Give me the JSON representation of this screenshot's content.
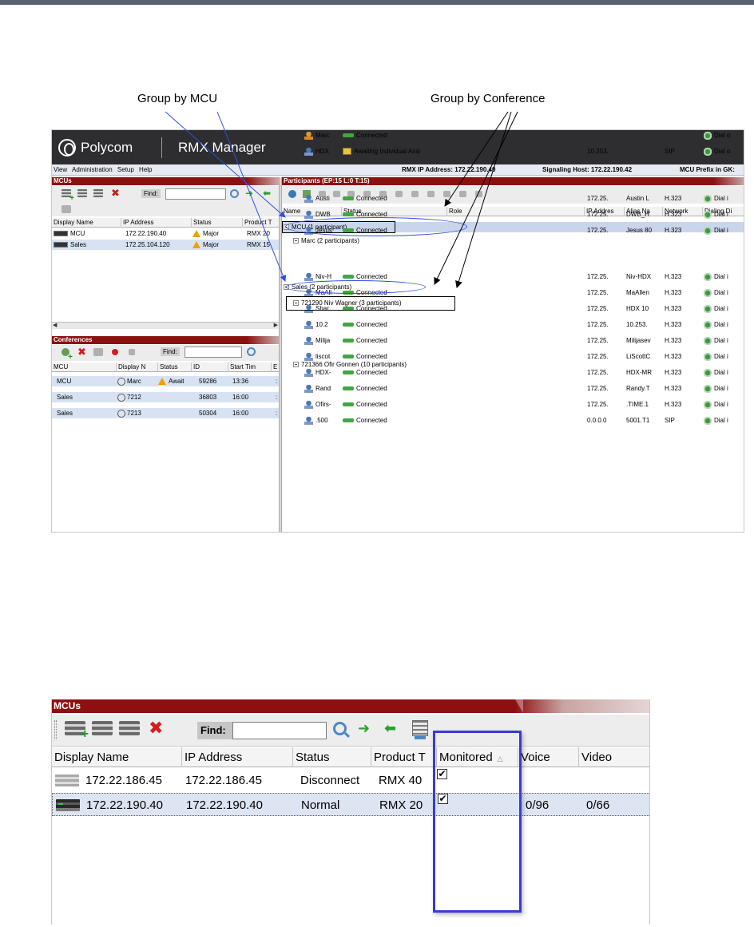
{
  "annotations": {
    "group_by_mcu": "Group by MCU",
    "group_by_conference": "Group by Conference"
  },
  "app": {
    "brand": "Polycom",
    "product": "RMX Manager",
    "menu": [
      "View",
      "Administration",
      "Setup",
      "Help"
    ],
    "rmx_ip": "RMX IP Address: 172.22.190.40",
    "signaling_host": "Signaling Host: 172.22.190.42",
    "mcu_prefix": "MCU Prefix in GK:"
  },
  "mcus_small": {
    "title": "MCUs",
    "find_label": "Find:",
    "columns": [
      "Display Name",
      "IP Address",
      "Status",
      "Product T"
    ],
    "rows": [
      {
        "name": "MCU",
        "ip": "172.22.190.40",
        "status": "Major",
        "product": "RMX 20"
      },
      {
        "name": "Sales",
        "ip": "172.25.104.120",
        "status": "Major",
        "product": "RMX 15"
      }
    ]
  },
  "conferences": {
    "title": "Conferences",
    "find_label": "Find:",
    "columns": [
      "MCU",
      "Display N",
      "Status",
      "ID",
      "Start Tim",
      "E"
    ],
    "rows": [
      {
        "mcu": "MCU",
        "name": "Marc",
        "status": "Await",
        "id": "59286",
        "start": "13:36",
        "end": ":"
      },
      {
        "mcu": "Sales",
        "name": "7212",
        "status": "",
        "id": "36803",
        "start": "16:00",
        "end": ":"
      },
      {
        "mcu": "Sales",
        "name": "7213",
        "status": "",
        "id": "50304",
        "start": "16:00",
        "end": ":"
      }
    ]
  },
  "participants": {
    "title": "Participants (EP:15 L:0 T:15)",
    "columns": [
      "Name",
      "Status",
      "Role",
      "IP Addres",
      "Alias Na",
      "Network",
      "Dialing Di"
    ],
    "groups": [
      {
        "label": "MCU (1 participant)",
        "level": 0,
        "kind": "mcu"
      },
      {
        "label": "Marc (2 participants)",
        "level": 1,
        "kind": "conf"
      },
      {
        "label": "Sales (2 participants)",
        "level": 0,
        "kind": "mcu"
      },
      {
        "label": "721290 Niv Wagner (3 participants)",
        "level": 1,
        "kind": "conf"
      },
      {
        "label": "721366 Ofir Gonnen (10 participants)",
        "level": 1,
        "kind": "conf"
      }
    ],
    "rows": [
      {
        "name": "Marc",
        "status": "Connected",
        "ip": "",
        "alias": "",
        "network": "",
        "dial": "Dial o",
        "icon": "orange"
      },
      {
        "name": "HDX",
        "status": "Awaiting Individual Assi",
        "ip": "10.253.",
        "alias": "",
        "network": "SIP",
        "dial": "Dial o",
        "icon": "blue"
      },
      {
        "name": "Austi",
        "status": "Connected",
        "ip": "172.25.",
        "alias": "Austin L",
        "network": "H.323",
        "dial": "Dial i",
        "icon": "blue"
      },
      {
        "name": "DWB",
        "status": "Connected",
        "ip": "172.25.",
        "alias": "DWB_H",
        "network": "H.323",
        "dial": "Dial i",
        "icon": "blue"
      },
      {
        "name": "Jesus",
        "status": "Connected",
        "ip": "172.25.",
        "alias": "Jesus 80",
        "network": "H.323",
        "dial": "Dial i",
        "icon": "blue"
      },
      {
        "name": "Niv-H",
        "status": "Connected",
        "ip": "172.25.",
        "alias": "Niv-HDX",
        "network": "H.323",
        "dial": "Dial i",
        "icon": "blue"
      },
      {
        "name": "MaAll",
        "status": "Connected",
        "ip": "172.25.",
        "alias": "MaAllen",
        "network": "H.323",
        "dial": "Dial i",
        "icon": "blue"
      },
      {
        "name": "Shar",
        "status": "Connected",
        "ip": "172.25.",
        "alias": "HDX 10",
        "network": "H.323",
        "dial": "Dial i",
        "icon": "blue"
      },
      {
        "name": "10.2",
        "status": "Connected",
        "ip": "172.25.",
        "alias": "10.253.",
        "network": "H.323",
        "dial": "Dial i",
        "icon": "blue"
      },
      {
        "name": "Milija",
        "status": "Connected",
        "ip": "172.25.",
        "alias": "Milijasev",
        "network": "H.323",
        "dial": "Dial i",
        "icon": "blue"
      },
      {
        "name": "liscot",
        "status": "Connected",
        "ip": "172.25.",
        "alias": "LiScottC",
        "network": "H.323",
        "dial": "Dial i",
        "icon": "blue"
      },
      {
        "name": "HDX-",
        "status": "Connected",
        "ip": "172.25.",
        "alias": "HDX-MR",
        "network": "H.323",
        "dial": "Dial i",
        "icon": "blue"
      },
      {
        "name": "Rand",
        "status": "Connected",
        "ip": "172.25.",
        "alias": "Randy.T",
        "network": "H.323",
        "dial": "Dial i",
        "icon": "blue"
      },
      {
        "name": "Ofirs-",
        "status": "Connected",
        "ip": "172.25.",
        "alias": ".TIME.1",
        "network": "H.323",
        "dial": "Dial i",
        "icon": "blue"
      },
      {
        "name": ".500",
        "status": "Connected",
        "ip": "0.0.0.0",
        "alias": "5001.T1",
        "network": "SIP",
        "dial": "Dial i",
        "icon": "blue"
      }
    ]
  },
  "mcus_large": {
    "title": "MCUs",
    "find_label": "Find:",
    "columns": [
      "Display Name",
      "IP Address",
      "Status",
      "Product T",
      "Monitored",
      "Voice",
      "Video"
    ],
    "rows": [
      {
        "name": "172.22.186.45",
        "ip": "172.22.186.45",
        "status": "Disconnect",
        "product": "RMX 40",
        "monitored": "✔",
        "voice": "",
        "video": "",
        "state": "off"
      },
      {
        "name": "172.22.190.40",
        "ip": "172.22.190.40",
        "status": "Normal",
        "product": "RMX 20",
        "monitored": "✔",
        "voice": "0/96",
        "video": "0/66",
        "state": "on"
      }
    ]
  }
}
